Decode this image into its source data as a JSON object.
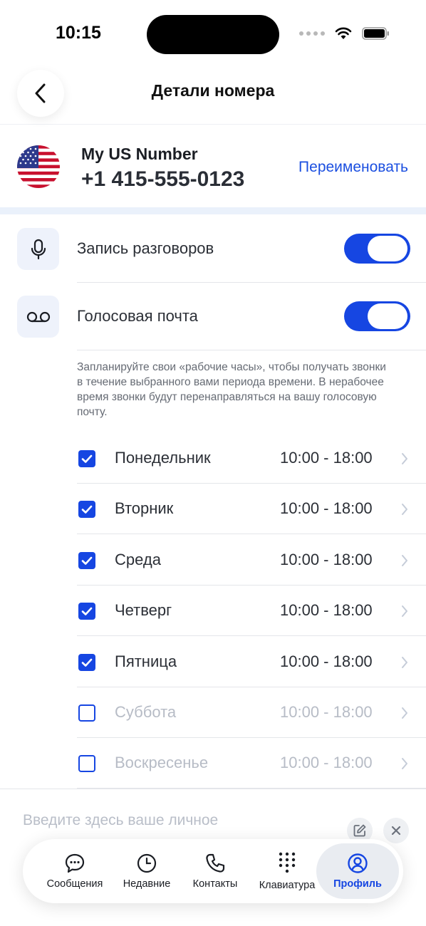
{
  "status_bar": {
    "time": "10:15"
  },
  "nav": {
    "title": "Детали номера"
  },
  "number": {
    "name": "My US Number",
    "value": "+1 415-555-0123",
    "rename_label": "Переименовать"
  },
  "settings": {
    "call_recording": {
      "label": "Запись разговоров",
      "enabled": true,
      "icon": "microphone-icon"
    },
    "voicemail": {
      "label": "Голосовая почта",
      "enabled": true,
      "icon": "voicemail-icon"
    }
  },
  "schedule": {
    "note": "Запланируйте свои «рабочие часы», чтобы получать звонки в течение выбранного вами периода времени. В нерабочее время звонки будут перенаправляться на вашу голосовую почту.",
    "days": [
      {
        "name": "Понедельник",
        "time": "10:00 - 18:00",
        "checked": true
      },
      {
        "name": "Вторник",
        "time": "10:00 - 18:00",
        "checked": true
      },
      {
        "name": "Среда",
        "time": "10:00 - 18:00",
        "checked": true
      },
      {
        "name": "Четверг",
        "time": "10:00 - 18:00",
        "checked": true
      },
      {
        "name": "Пятница",
        "time": "10:00 - 18:00",
        "checked": true
      },
      {
        "name": "Суббота",
        "time": "10:00 - 18:00",
        "checked": false
      },
      {
        "name": "Воскресенье",
        "time": "10:00 - 18:00",
        "checked": false
      }
    ]
  },
  "note": {
    "placeholder": "Введите здесь ваше личное"
  },
  "tabbar": {
    "messages": "Сообщения",
    "recent": "Недавние",
    "contacts": "Контакты",
    "keypad": "Клавиатура",
    "profile": "Профиль"
  },
  "colors": {
    "accent": "#1646e2",
    "icon_bg": "#eef2fb",
    "band": "#eaf1fb"
  }
}
